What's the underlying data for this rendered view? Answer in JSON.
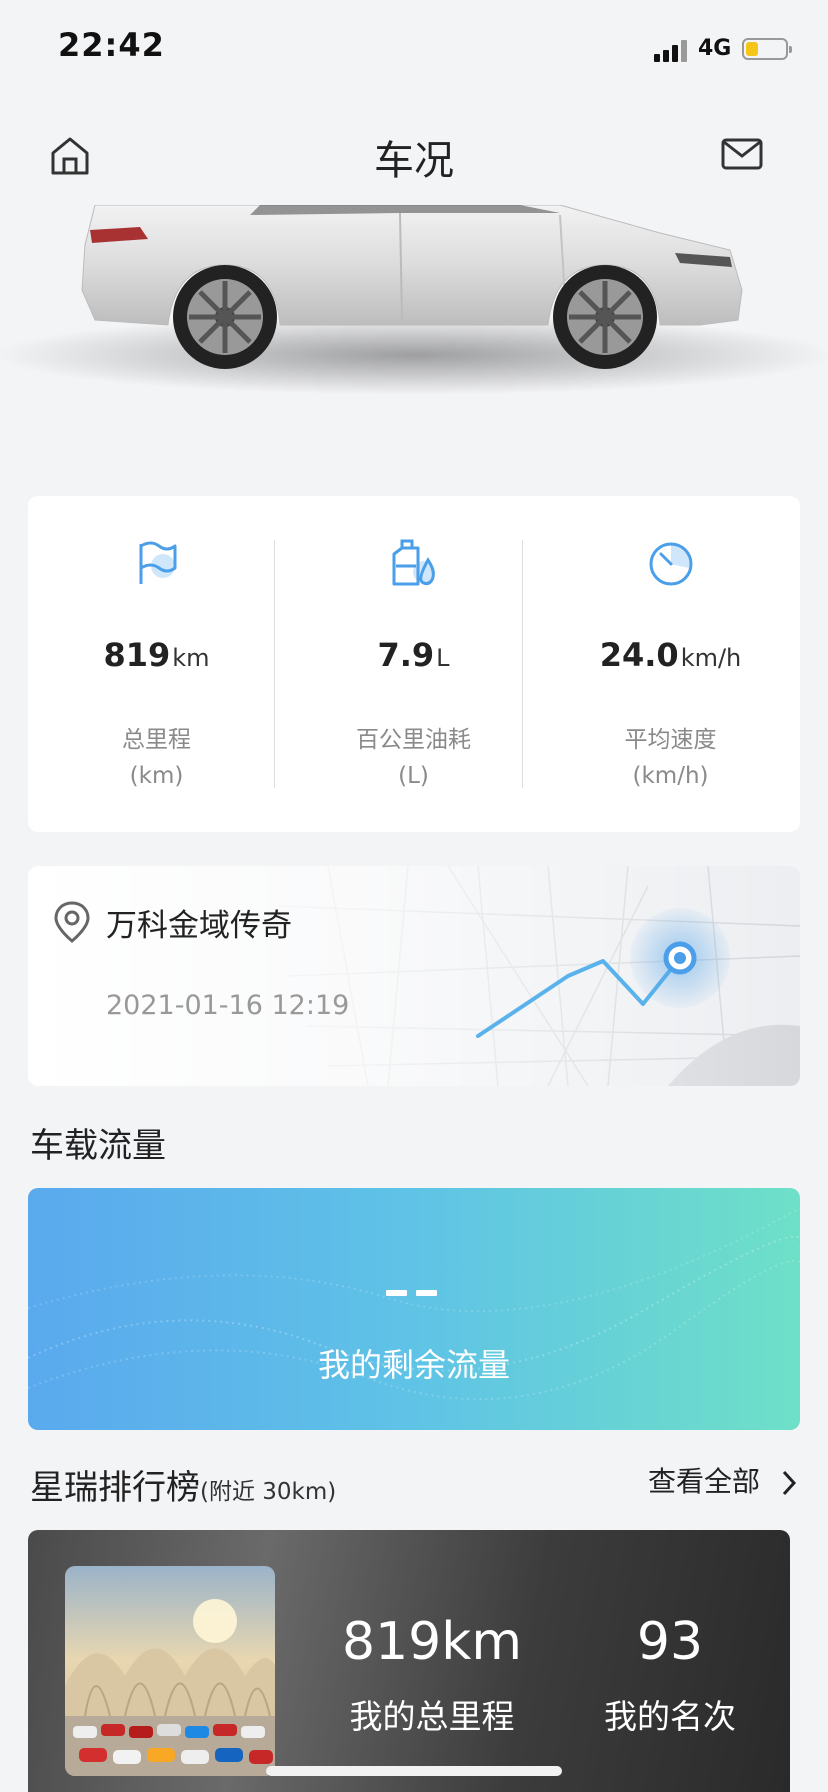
{
  "status": {
    "time": "22:42",
    "network": "4G",
    "battery_level": 0.25
  },
  "header": {
    "title": "车况",
    "left_icon": "home-icon",
    "right_icon": "mail-icon"
  },
  "stats": [
    {
      "icon": "flag-icon",
      "value": "819",
      "unit": "km",
      "label": "总里程",
      "sublabel": "(km)"
    },
    {
      "icon": "fuel-icon",
      "value": "7.9",
      "unit": "L",
      "label": "百公里油耗",
      "sublabel": "(L)"
    },
    {
      "icon": "speedometer-icon",
      "value": "24.0",
      "unit": "km/h",
      "label": "平均速度",
      "sublabel": "(km/h)"
    }
  ],
  "location": {
    "name": "万科金域传奇",
    "time": "2021-01-16 12:19",
    "icon": "location-pin-icon"
  },
  "traffic": {
    "section_title": "车载流量",
    "value": "- -",
    "label": "我的剩余流量"
  },
  "ranking": {
    "title": "星瑞排行榜",
    "subtitle": "(附近 30km)",
    "view_all": "查看全部",
    "mileage_value": "819km",
    "mileage_label": "我的总里程",
    "rank_value": "93",
    "rank_label": "我的名次"
  },
  "colors": {
    "accent": "#4a9fe8",
    "traffic_start": "#5aa9ee",
    "traffic_end": "#6ee0c7"
  }
}
